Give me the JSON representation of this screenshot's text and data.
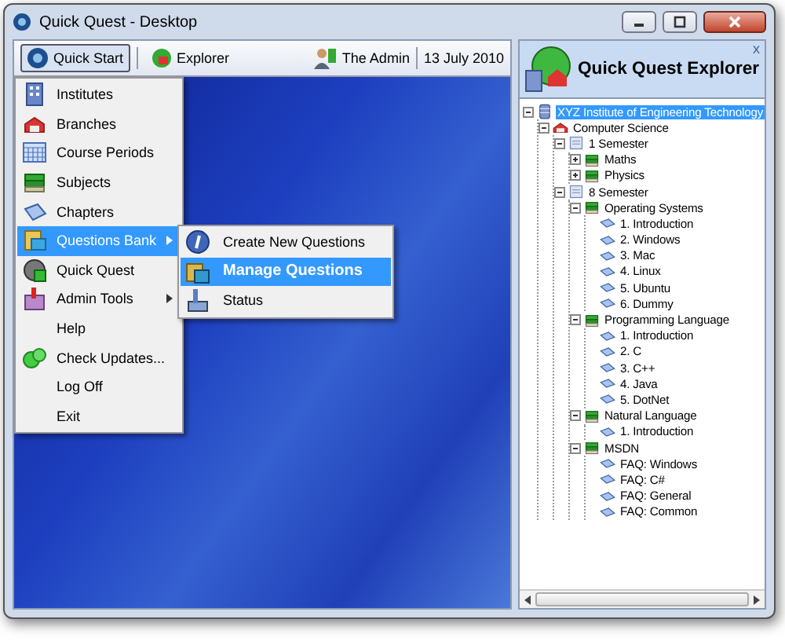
{
  "window": {
    "title": "Quick Quest - Desktop"
  },
  "toolbar": {
    "quick_start": "Quick Start",
    "explorer": "Explorer",
    "user": "The Admin",
    "date": "13 July 2010"
  },
  "menu": [
    {
      "label": "Institutes",
      "submenu": false,
      "selected": false
    },
    {
      "label": "Branches",
      "submenu": false,
      "selected": false
    },
    {
      "label": "Course Periods",
      "submenu": false,
      "selected": false
    },
    {
      "label": "Subjects",
      "submenu": false,
      "selected": false
    },
    {
      "label": "Chapters",
      "submenu": false,
      "selected": false
    },
    {
      "label": "Questions Bank",
      "submenu": true,
      "selected": true
    },
    {
      "label": "Quick Quest",
      "submenu": false,
      "selected": false
    },
    {
      "label": "Admin Tools",
      "submenu": true,
      "selected": false
    },
    {
      "label": "Help",
      "submenu": false,
      "selected": false
    },
    {
      "label": "Check Updates...",
      "submenu": false,
      "selected": false
    },
    {
      "label": "Log Off",
      "submenu": false,
      "selected": false
    },
    {
      "label": "Exit",
      "submenu": false,
      "selected": false
    }
  ],
  "submenu": [
    {
      "label": "Create New Questions",
      "selected": false
    },
    {
      "label": "Manage Questions",
      "selected": true
    },
    {
      "label": "Status",
      "selected": false
    }
  ],
  "explorer": {
    "title": "Quick Quest Explorer",
    "close": "x",
    "tree": [
      {
        "label": "XYZ Institute of Engineering Technology",
        "kind": "institute",
        "selected": true,
        "expanded": true,
        "children": [
          {
            "label": "Computer Science",
            "kind": "branch",
            "selected": false,
            "expanded": true,
            "children": [
              {
                "label": "1 Semester",
                "kind": "semester",
                "selected": false,
                "expanded": true,
                "children": [
                  {
                    "label": "Maths",
                    "kind": "subject",
                    "selected": false,
                    "expanded": false
                  },
                  {
                    "label": "Physics",
                    "kind": "subject",
                    "selected": false,
                    "expanded": false
                  }
                ]
              },
              {
                "label": "8 Semester",
                "kind": "semester",
                "selected": false,
                "expanded": true,
                "children": [
                  {
                    "label": "Operating Systems",
                    "kind": "subject",
                    "selected": false,
                    "expanded": true,
                    "children": [
                      {
                        "label": "1. Introduction",
                        "kind": "chapter",
                        "selected": false
                      },
                      {
                        "label": "2. Windows",
                        "kind": "chapter",
                        "selected": false
                      },
                      {
                        "label": "3. Mac",
                        "kind": "chapter",
                        "selected": false
                      },
                      {
                        "label": "4. Linux",
                        "kind": "chapter",
                        "selected": false
                      },
                      {
                        "label": "5. Ubuntu",
                        "kind": "chapter",
                        "selected": false
                      },
                      {
                        "label": "6. Dummy",
                        "kind": "chapter",
                        "selected": false
                      }
                    ]
                  },
                  {
                    "label": "Programming Language",
                    "kind": "subject",
                    "selected": false,
                    "expanded": true,
                    "children": [
                      {
                        "label": "1. Introduction",
                        "kind": "chapter",
                        "selected": false
                      },
                      {
                        "label": "2. C",
                        "kind": "chapter",
                        "selected": false
                      },
                      {
                        "label": "3. C++",
                        "kind": "chapter",
                        "selected": false
                      },
                      {
                        "label": "4. Java",
                        "kind": "chapter",
                        "selected": false
                      },
                      {
                        "label": "5. DotNet",
                        "kind": "chapter",
                        "selected": false
                      }
                    ]
                  },
                  {
                    "label": "Natural Language",
                    "kind": "subject",
                    "selected": false,
                    "expanded": true,
                    "children": [
                      {
                        "label": "1. Introduction",
                        "kind": "chapter",
                        "selected": false
                      }
                    ]
                  },
                  {
                    "label": "MSDN",
                    "kind": "subject",
                    "selected": false,
                    "expanded": true,
                    "children": [
                      {
                        "label": "FAQ: Windows",
                        "kind": "chapter",
                        "selected": false
                      },
                      {
                        "label": "FAQ: C#",
                        "kind": "chapter",
                        "selected": false
                      },
                      {
                        "label": "FAQ: General",
                        "kind": "chapter",
                        "selected": false
                      },
                      {
                        "label": "FAQ: Common",
                        "kind": "chapter",
                        "selected": false
                      }
                    ]
                  }
                ]
              }
            ]
          }
        ]
      }
    ]
  }
}
